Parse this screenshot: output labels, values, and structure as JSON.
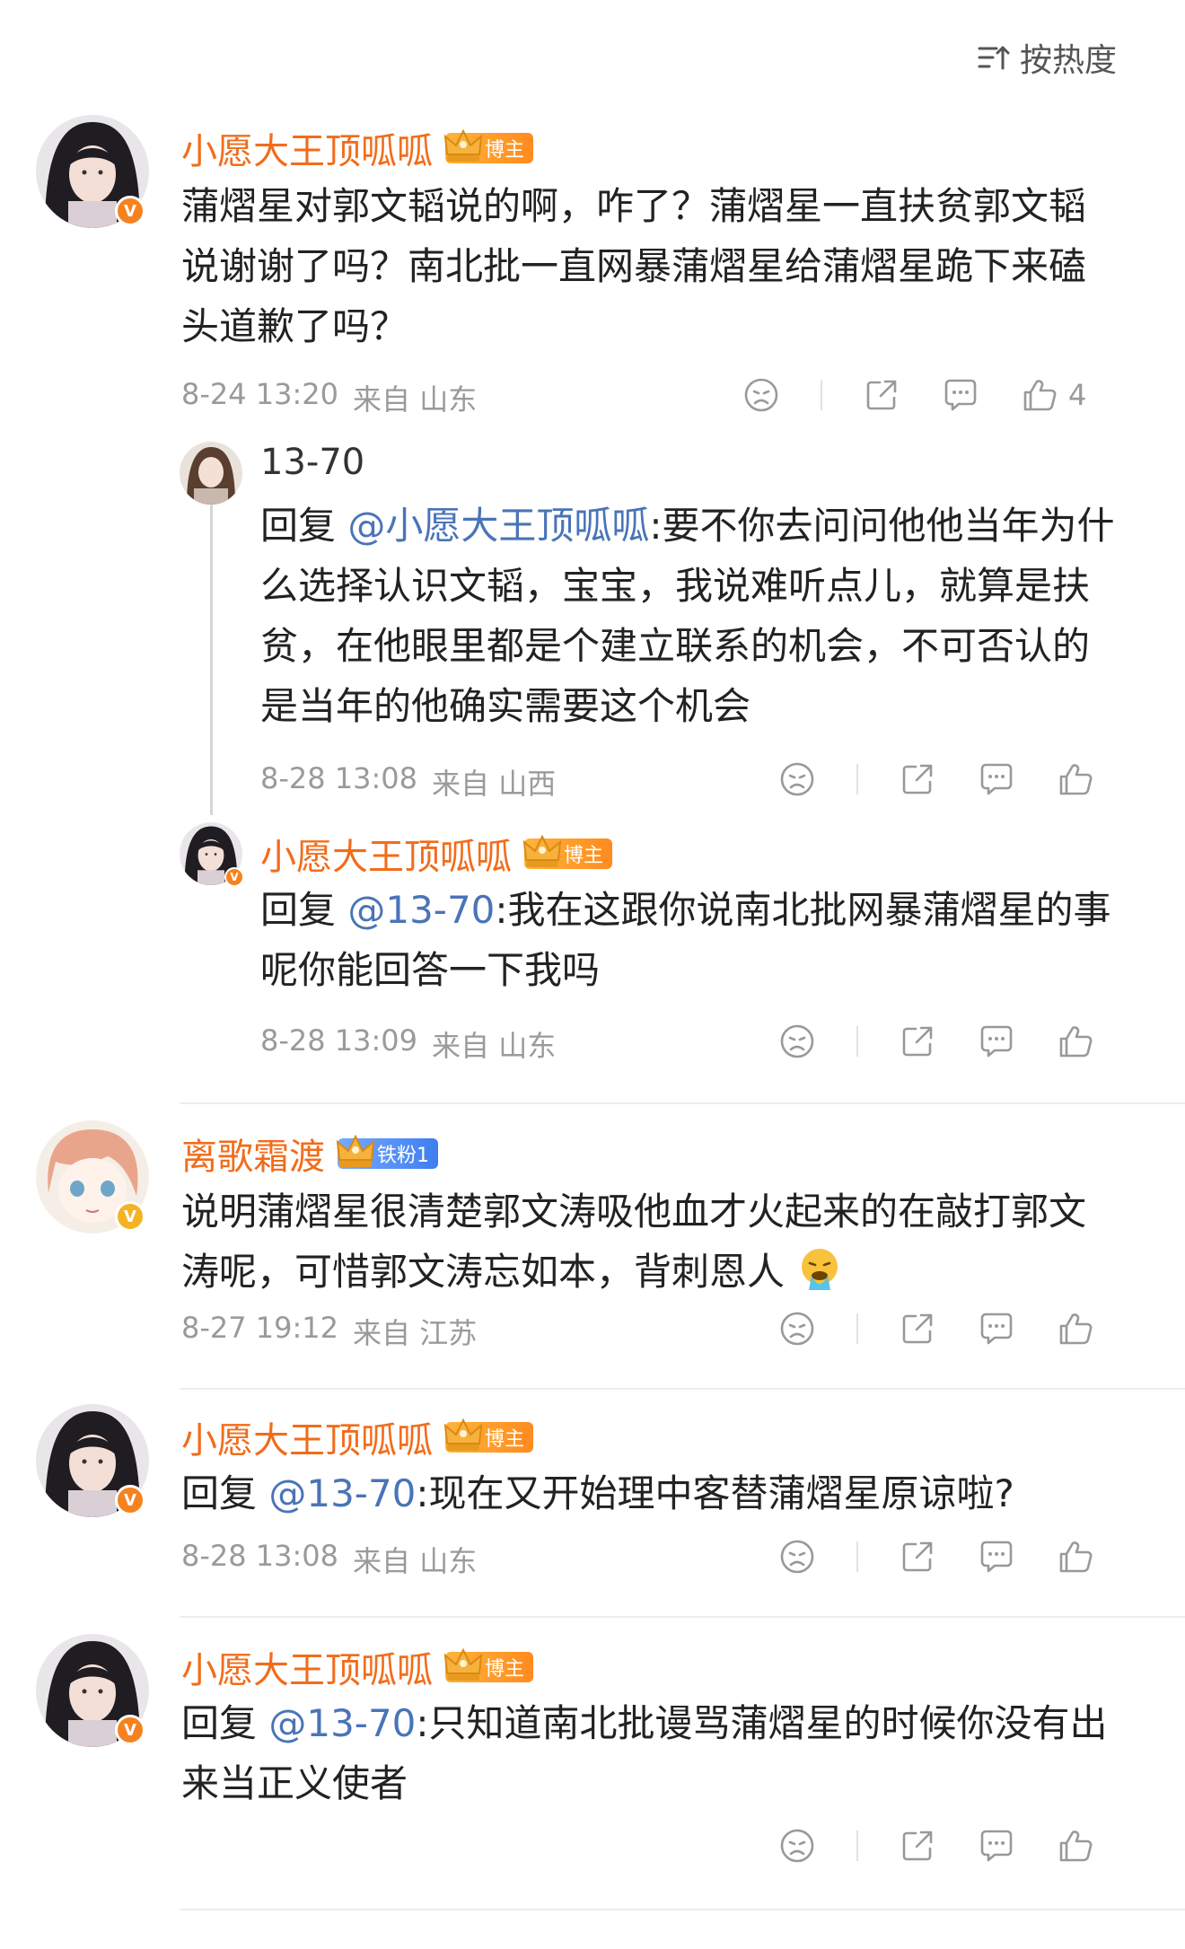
{
  "sort": {
    "label": "按热度",
    "icon": "sort-icon"
  },
  "colors": {
    "name_orange": "#f26c1a",
    "mention_blue": "#4a74b8",
    "meta_grey": "#9a9a9a",
    "badge_orange": "#f6821f"
  },
  "comments": [
    {
      "name": "小愿大王顶呱呱",
      "tag": "博主",
      "text": "蒲熠星对郭文韬说的啊，咋了？蒲熠星一直扶贫郭文韬说谢谢了吗？南北批一直网暴蒲熠星给蒲熠星跪下来磕头道歉了吗？",
      "time": "8-24 13:20",
      "from": "来自 山东",
      "likes": "4"
    },
    {
      "name": "13-70",
      "reply_prefix": "回复 ",
      "mention": "@小愿大王顶呱呱",
      "text": ":要不你去问问他他当年为什么选择认识文韬，宝宝，我说难听点儿，就算是扶贫，在他眼里都是个建立联系的机会，不可否认的是当年的他确实需要这个机会",
      "time": "8-28 13:08",
      "from": "来自 山西"
    },
    {
      "name": "小愿大王顶呱呱",
      "tag": "博主",
      "reply_prefix": "回复 ",
      "mention": "@13-70",
      "text": ":我在这跟你说南北批网暴蒲熠星的事呢你能回答一下我吗",
      "time": "8-28 13:09",
      "from": "来自 山东"
    },
    {
      "name": "离歌霜渡",
      "tag": "铁粉1",
      "text": "说明蒲熠星很清楚郭文涛吸他血才火起来的在敲打郭文涛呢，可惜郭文涛忘如本，背刺恩人",
      "emoji": "vomit-face-emoji",
      "time": "8-27 19:12",
      "from": "来自 江苏"
    },
    {
      "name": "小愿大王顶呱呱",
      "tag": "博主",
      "reply_prefix": "回复 ",
      "mention": "@13-70",
      "text": ":现在又开始理中客替蒲熠星原谅啦?",
      "time": "8-28 13:08",
      "from": "来自 山东"
    },
    {
      "name": "小愿大王顶呱呱",
      "tag": "博主",
      "reply_prefix": "回复 ",
      "mention": "@13-70",
      "text": ":只知道南北批谩骂蒲熠星的时候你没有出来当正义使者"
    }
  ]
}
